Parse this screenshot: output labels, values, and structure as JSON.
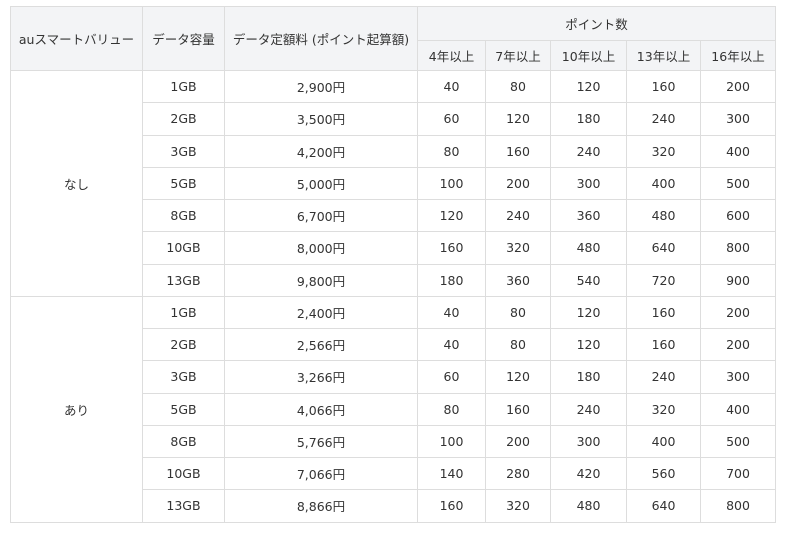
{
  "headers": {
    "smart_value": "auスマートバリュー",
    "data_capacity": "データ容量",
    "price": "データ定額料 (ポイント起算額)",
    "points": "ポイント数",
    "years": [
      "4年以上",
      "7年以上",
      "10年以上",
      "13年以上",
      "16年以上"
    ]
  },
  "groups": [
    {
      "label": "なし",
      "rows": [
        {
          "data": "1GB",
          "price": "2,900円",
          "points": [
            "40",
            "80",
            "120",
            "160",
            "200"
          ]
        },
        {
          "data": "2GB",
          "price": "3,500円",
          "points": [
            "60",
            "120",
            "180",
            "240",
            "300"
          ]
        },
        {
          "data": "3GB",
          "price": "4,200円",
          "points": [
            "80",
            "160",
            "240",
            "320",
            "400"
          ]
        },
        {
          "data": "5GB",
          "price": "5,000円",
          "points": [
            "100",
            "200",
            "300",
            "400",
            "500"
          ]
        },
        {
          "data": "8GB",
          "price": "6,700円",
          "points": [
            "120",
            "240",
            "360",
            "480",
            "600"
          ]
        },
        {
          "data": "10GB",
          "price": "8,000円",
          "points": [
            "160",
            "320",
            "480",
            "640",
            "800"
          ]
        },
        {
          "data": "13GB",
          "price": "9,800円",
          "points": [
            "180",
            "360",
            "540",
            "720",
            "900"
          ]
        }
      ]
    },
    {
      "label": "あり",
      "rows": [
        {
          "data": "1GB",
          "price": "2,400円",
          "points": [
            "40",
            "80",
            "120",
            "160",
            "200"
          ]
        },
        {
          "data": "2GB",
          "price": "2,566円",
          "points": [
            "40",
            "80",
            "120",
            "160",
            "200"
          ]
        },
        {
          "data": "3GB",
          "price": "3,266円",
          "points": [
            "60",
            "120",
            "180",
            "240",
            "300"
          ]
        },
        {
          "data": "5GB",
          "price": "4,066円",
          "points": [
            "80",
            "160",
            "240",
            "320",
            "400"
          ]
        },
        {
          "data": "8GB",
          "price": "5,766円",
          "points": [
            "100",
            "200",
            "300",
            "400",
            "500"
          ]
        },
        {
          "data": "10GB",
          "price": "7,066円",
          "points": [
            "140",
            "280",
            "420",
            "560",
            "700"
          ]
        },
        {
          "data": "13GB",
          "price": "8,866円",
          "points": [
            "160",
            "320",
            "480",
            "640",
            "800"
          ]
        }
      ]
    }
  ]
}
